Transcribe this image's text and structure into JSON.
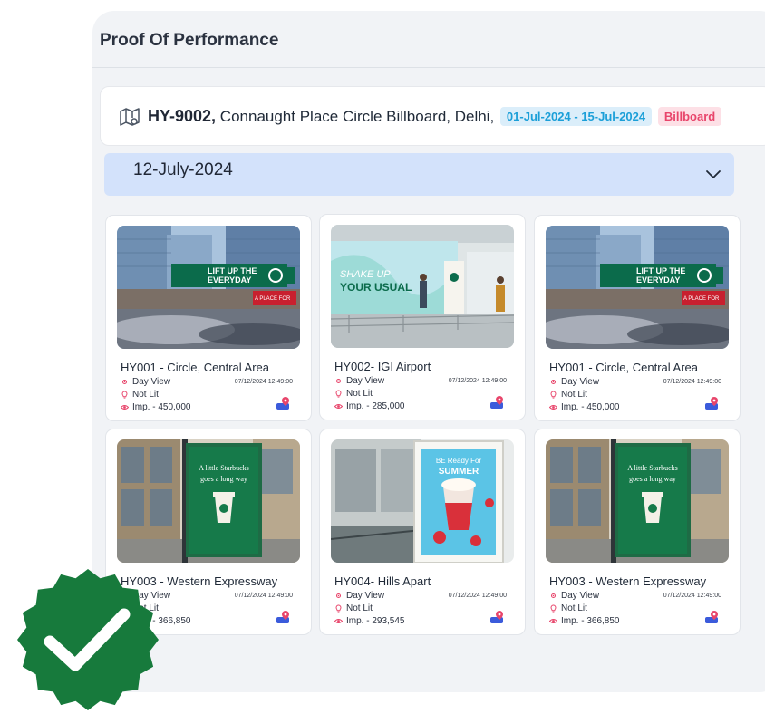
{
  "panel": {
    "title": "Proof Of Performance"
  },
  "site": {
    "code": "HY-9002,",
    "address": "Connaught Place Circle Billboard, Delhi,",
    "date_range": "01-Jul-2024 - 15-Jul-2024",
    "type": "Billboard"
  },
  "date_selector": {
    "value": "12-July-2024"
  },
  "labels": {
    "view": "Day View",
    "lit": "Not Lit"
  },
  "cards": [
    {
      "title": "HY001 - Circle, Central Area",
      "timestamp": "07/12/2024 12:49:00",
      "impressions": "Imp. - 450,000"
    },
    {
      "title": "HY002- IGI Airport",
      "timestamp": "07/12/2024 12:49:00",
      "impressions": "Imp. - 285,000"
    },
    {
      "title": "HY001 - Circle, Central Area",
      "timestamp": "07/12/2024 12:49:00",
      "impressions": "Imp. - 450,000"
    },
    {
      "title": "HY003 - Western Expressway",
      "timestamp": "07/12/2024 12:49:00",
      "impressions": "Imp. - 366,850"
    },
    {
      "title": "HY004- Hills Apart",
      "timestamp": "07/12/2024 12:49:00",
      "impressions": "Imp. - 293,545"
    },
    {
      "title": "HY003 - Western Expressway",
      "timestamp": "07/12/2024 12:49:00",
      "impressions": "Imp. - 366,850"
    }
  ],
  "photo_text": {
    "billboard": [
      "LIFT UP THE",
      "EVERYDAY",
      "A PLACE FOR"
    ],
    "airport": [
      "SHAKE UP",
      "YOUR USUAL"
    ],
    "bus_shelter": [
      "A little Starbucks",
      "goes a long way"
    ],
    "summer": [
      "BE Ready For",
      "SUMMER"
    ]
  },
  "colors": {
    "accent_pink": "#e8456b",
    "accent_blue": "#1b9fd8",
    "badge_green": "#177a3c"
  }
}
